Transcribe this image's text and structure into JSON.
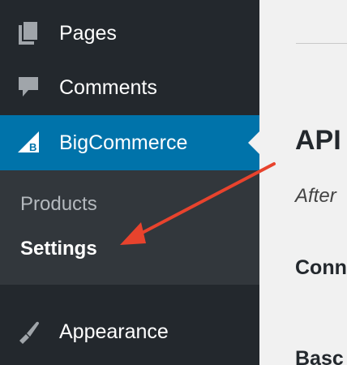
{
  "sidebar": {
    "items": [
      {
        "label": "Pages",
        "icon": "pages-icon"
      },
      {
        "label": "Comments",
        "icon": "comment-bubble-icon"
      },
      {
        "label": "BigCommerce",
        "icon": "bigcommerce-logo-icon",
        "active": true
      },
      {
        "label": "Appearance",
        "icon": "paintbrush-icon"
      }
    ],
    "submenu": [
      {
        "label": "Products"
      },
      {
        "label": "Settings",
        "current": true
      }
    ]
  },
  "main": {
    "heading": "API",
    "subtext": "After",
    "section_1": "Conn",
    "section_2": "Basc"
  },
  "annotation": {
    "type": "arrow",
    "color": "#e8432d",
    "target": "Settings"
  },
  "colors": {
    "sidebar_bg": "#23282d",
    "submenu_bg": "#32373c",
    "active_bg": "#0073aa",
    "content_bg": "#f1f1f1"
  }
}
